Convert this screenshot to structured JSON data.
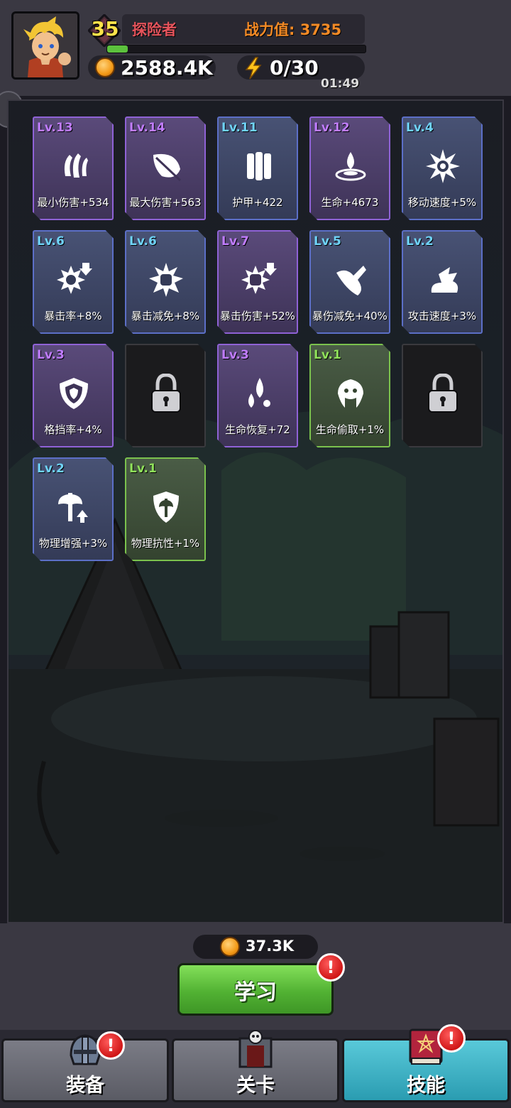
{
  "player": {
    "level": "35",
    "name": "探险者",
    "power_label": "战力值: 3735",
    "xp_progress": 0.08,
    "gold": "2588.4K",
    "energy": "0/30",
    "energy_timer": "01:49"
  },
  "skills": [
    {
      "level": "Lv.13",
      "label": "最小伤害+534",
      "rarity": "purple",
      "icon": "claw-icon"
    },
    {
      "level": "Lv.14",
      "label": "最大伤害+563",
      "rarity": "purple",
      "icon": "leaf-blade-icon"
    },
    {
      "level": "Lv.11",
      "label": "护甲+422",
      "rarity": "blue",
      "icon": "armor-icon"
    },
    {
      "level": "Lv.12",
      "label": "生命+4673",
      "rarity": "purple",
      "icon": "droplet-icon"
    },
    {
      "level": "Lv.4",
      "label": "移动速度+5%",
      "rarity": "blue",
      "icon": "spiky-orb-icon"
    },
    {
      "level": "Lv.6",
      "label": "暴击率+8%",
      "rarity": "blue",
      "icon": "crit-rate-icon"
    },
    {
      "level": "Lv.6",
      "label": "暴击减免+8%",
      "rarity": "blue",
      "icon": "fist-burst-icon"
    },
    {
      "level": "Lv.7",
      "label": "暴击伤害+52%",
      "rarity": "purple",
      "icon": "fist-arrow-icon"
    },
    {
      "level": "Lv.5",
      "label": "暴伤减免+40%",
      "rarity": "blue",
      "icon": "broken-blade-icon"
    },
    {
      "level": "Lv.2",
      "label": "攻击速度+3%",
      "rarity": "blue",
      "icon": "wind-icon"
    },
    {
      "level": "Lv.3",
      "label": "格挡率+4%",
      "rarity": "purple",
      "icon": "shield-icon"
    },
    {
      "level": "",
      "label": "",
      "rarity": "locked",
      "icon": "lock-icon"
    },
    {
      "level": "Lv.3",
      "label": "生命恢复+72",
      "rarity": "purple",
      "icon": "drops-icon"
    },
    {
      "level": "Lv.1",
      "label": "生命偷取+1%",
      "rarity": "green",
      "icon": "lifesteal-icon"
    },
    {
      "level": "",
      "label": "",
      "rarity": "locked",
      "icon": "lock-icon"
    },
    {
      "level": "Lv.2",
      "label": "物理增强+3%",
      "rarity": "blue",
      "icon": "axe-up-icon"
    },
    {
      "level": "Lv.1",
      "label": "物理抗性+1%",
      "rarity": "green",
      "icon": "axe-shield-icon"
    }
  ],
  "learn": {
    "cost": "37.3K",
    "button_label": "学习",
    "alert": "!"
  },
  "nav": {
    "equipment": "装备",
    "stages": "关卡",
    "skills": "技能",
    "alert": "!"
  },
  "colors": {
    "accent_green": "#52b233",
    "active_tab": "#2a9cb1",
    "rarity_purple": "#8f62d6",
    "rarity_blue": "#5c6fc7",
    "rarity_green": "#7bc24d"
  }
}
